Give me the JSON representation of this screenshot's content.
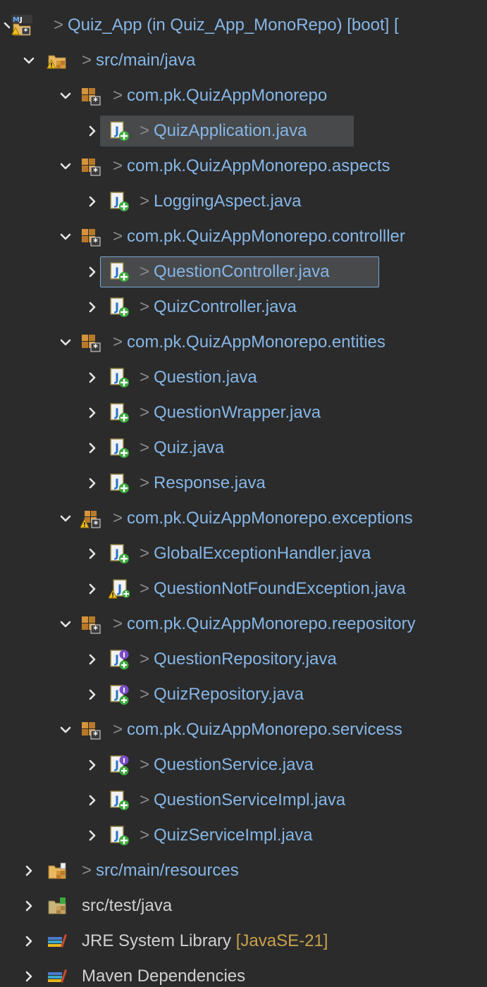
{
  "explorer": {
    "rows": [
      {
        "level": 0,
        "chevron": "partial",
        "icon": "maven-project-icon",
        "prefix": ">",
        "name": "Quiz_App (in Quiz_App_MonoRepo) [boot] [",
        "style": "link"
      },
      {
        "level": 1,
        "chevron": "down",
        "icon": "source-folder-warning-icon",
        "prefix": ">",
        "name": "src/main/java",
        "style": "link"
      },
      {
        "level": 2,
        "chevron": "down",
        "icon": "package-icon",
        "prefix": ">",
        "name": "com.pk.QuizAppMonorepo",
        "style": "link"
      },
      {
        "level": 3,
        "chevron": "right",
        "icon": "java-class-icon",
        "prefix": ">",
        "name": "QuizApplication.java",
        "style": "link",
        "highlight": "gray"
      },
      {
        "level": 2,
        "chevron": "down",
        "icon": "package-icon",
        "prefix": ">",
        "name": "com.pk.QuizAppMonorepo.aspects",
        "style": "link"
      },
      {
        "level": 3,
        "chevron": "right",
        "icon": "java-class-icon",
        "prefix": ">",
        "name": "LoggingAspect.java",
        "style": "link"
      },
      {
        "level": 2,
        "chevron": "down",
        "icon": "package-icon",
        "prefix": ">",
        "name": "com.pk.QuizAppMonorepo.controlller",
        "style": "link"
      },
      {
        "level": 3,
        "chevron": "right",
        "icon": "java-class-icon",
        "prefix": ">",
        "name": "QuestionController.java",
        "style": "link",
        "highlight": "focus"
      },
      {
        "level": 3,
        "chevron": "right",
        "icon": "java-class-icon",
        "prefix": ">",
        "name": "QuizController.java",
        "style": "link"
      },
      {
        "level": 2,
        "chevron": "down",
        "icon": "package-icon",
        "prefix": ">",
        "name": "com.pk.QuizAppMonorepo.entities",
        "style": "link"
      },
      {
        "level": 3,
        "chevron": "right",
        "icon": "java-class-icon",
        "prefix": ">",
        "name": "Question.java",
        "style": "link"
      },
      {
        "level": 3,
        "chevron": "right",
        "icon": "java-class-icon",
        "prefix": ">",
        "name": "QuestionWrapper.java",
        "style": "link"
      },
      {
        "level": 3,
        "chevron": "right",
        "icon": "java-class-icon",
        "prefix": ">",
        "name": "Quiz.java",
        "style": "link"
      },
      {
        "level": 3,
        "chevron": "right",
        "icon": "java-class-icon",
        "prefix": ">",
        "name": "Response.java",
        "style": "link"
      },
      {
        "level": 2,
        "chevron": "down",
        "icon": "package-warning-icon",
        "prefix": ">",
        "name": "com.pk.QuizAppMonorepo.exceptions",
        "style": "link"
      },
      {
        "level": 3,
        "chevron": "right",
        "icon": "java-class-icon",
        "prefix": ">",
        "name": "GlobalExceptionHandler.java",
        "style": "link"
      },
      {
        "level": 3,
        "chevron": "right",
        "icon": "java-class-warning-icon",
        "prefix": ">",
        "name": "QuestionNotFoundException.java",
        "style": "link"
      },
      {
        "level": 2,
        "chevron": "down",
        "icon": "package-icon",
        "prefix": ">",
        "name": "com.pk.QuizAppMonorepo.reepository",
        "style": "link"
      },
      {
        "level": 3,
        "chevron": "right",
        "icon": "java-interface-icon",
        "prefix": ">",
        "name": "QuestionRepository.java",
        "style": "link"
      },
      {
        "level": 3,
        "chevron": "right",
        "icon": "java-interface-icon",
        "prefix": ">",
        "name": "QuizRepository.java",
        "style": "link"
      },
      {
        "level": 2,
        "chevron": "down",
        "icon": "package-icon",
        "prefix": ">",
        "name": "com.pk.QuizAppMonorepo.servicess",
        "style": "link"
      },
      {
        "level": 3,
        "chevron": "right",
        "icon": "java-interface-icon",
        "prefix": ">",
        "name": "QuestionService.java",
        "style": "link"
      },
      {
        "level": 3,
        "chevron": "right",
        "icon": "java-class-icon",
        "prefix": ">",
        "name": "QuestionServiceImpl.java",
        "style": "link"
      },
      {
        "level": 3,
        "chevron": "right",
        "icon": "java-class-icon",
        "prefix": ">",
        "name": "QuizServiceImpl.java",
        "style": "link"
      },
      {
        "level": 1,
        "chevron": "right",
        "icon": "resource-folder-icon",
        "prefix": ">",
        "name": "src/main/resources",
        "style": "link"
      },
      {
        "level": 1,
        "chevron": "right",
        "icon": "test-folder-icon",
        "prefix": "",
        "name": "src/test/java",
        "style": "plain"
      },
      {
        "level": 1,
        "chevron": "right",
        "icon": "library-icon",
        "prefix": "",
        "name": "JRE System Library ",
        "extra": "[JavaSE-21]",
        "style": "plain"
      },
      {
        "level": 1,
        "chevron": "right",
        "icon": "library-icon",
        "prefix": "",
        "name": "Maven Dependencies",
        "style": "plain"
      }
    ]
  },
  "colors": {
    "background": "#2b2b2b",
    "link_text": "#86b6e6",
    "plain_text": "#d0d0d0",
    "decoration_gt": "#8a8a8a",
    "decoration_extra": "#c8a24c",
    "selection": "#47494b",
    "focus_border": "#7aa7d6"
  }
}
